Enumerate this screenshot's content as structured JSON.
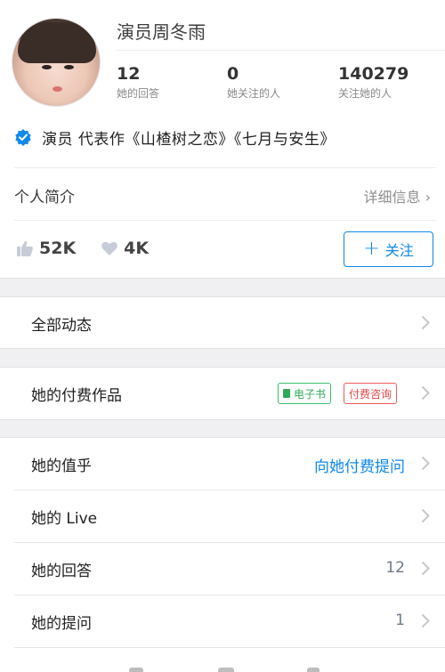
{
  "profile": {
    "name": "演员周冬雨",
    "stats": [
      {
        "value": "12",
        "label": "她的回答"
      },
      {
        "value": "0",
        "label": "她关注的人"
      },
      {
        "value": "140279",
        "label": "关注她的人"
      }
    ],
    "verification": "演员 代表作《山楂树之恋》《七月与安生》"
  },
  "intro": {
    "label": "个人简介",
    "link": "详细信息 ›"
  },
  "actions": {
    "likes": "52K",
    "favorites": "4K",
    "follow_label": "关注",
    "follow_plus": "+"
  },
  "sections": {
    "all_activity": "全部动态",
    "paid_works": "她的付费作品",
    "tag_ebook": "电子书",
    "tag_consult": "付费咨询",
    "zhi": "她的值乎",
    "zhi_link": "向她付费提问",
    "live": "她的 Live",
    "answers": "她的回答",
    "answers_count": "12",
    "questions": "她的提问",
    "questions_count": "1"
  },
  "colors": {
    "accent": "#0f88eb",
    "green_tag": "#2fa858",
    "red_tag": "#e24747",
    "section_gap": "#f0f0f2"
  },
  "icons": [
    "avatar",
    "verified-badge-icon",
    "thumbs-up-icon",
    "heart-icon",
    "chevron-right-icon",
    "ebook-icon"
  ]
}
